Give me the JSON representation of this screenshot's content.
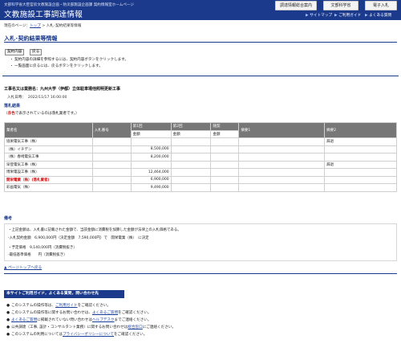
{
  "header": {
    "department": "文部科学省大臣官房文教施設企画・防災部施設企画課 契約情報室ホームページ",
    "site_title": "文教施設工事調達情報",
    "buttons": [
      "調達情報総合案内",
      "文部科学省",
      "電子入札"
    ],
    "nav": [
      "サイトマップ",
      "ご利用ガイド",
      "よくある質問"
    ]
  },
  "breadcrumb": {
    "prefix": "現在のページ：",
    "top": "トップ",
    "sep": " > ",
    "current": "入札･契約結果等情報"
  },
  "page_title": "入札･契約結果等情報",
  "toolbar": {
    "contract_btn": "契約内容",
    "back_btn": "戻る"
  },
  "hints": [
    "・ 契約内容の詳細を参照するには、契約内容ボタンをクリックします。",
    "・ 一覧画面に戻るには、戻るボタンをクリックします。"
  ],
  "work": {
    "name": "工事名又は業務名：九州大学（伊都）立体駐車場他照明更新工事",
    "date_label": "入札日時：",
    "date": "2022/11/17 16:00:00"
  },
  "results_label": "落札結果",
  "legend": {
    "open": "（",
    "red": "赤色",
    "rest": "で表示されているのは落札業者です。）"
  },
  "table": {
    "headers": [
      "業者名",
      "入札番号",
      "第1回",
      "第2回",
      "随契",
      "摘要1",
      "摘要2"
    ],
    "sub": [
      "金額",
      "金額",
      "金額"
    ],
    "rows": [
      {
        "name": "協栄電気工事（株）",
        "amount": "",
        "remark2": "辞退"
      },
      {
        "name": "（株）イチデン",
        "amount": "8,500,000",
        "remark2": ""
      },
      {
        "name": "（株）春崎電気工事",
        "amount": "8,200,000",
        "remark2": ""
      },
      {
        "name": "早登電気工事（株）",
        "amount": "",
        "remark2": "辞退"
      },
      {
        "name": "博栄電設工事（株）",
        "amount": "12,464,000",
        "remark2": ""
      },
      {
        "name": "開栄電業（株）(落札業者)",
        "amount": "6,900,000",
        "remark2": "",
        "winner": true
      },
      {
        "name": "彩画電気（株）",
        "amount": "9,490,000",
        "remark2": ""
      }
    ]
  },
  "biko": {
    "label": "備考",
    "lines": [
      "・上記金額は、入札書に記載された金額で、当該金額に消費税を加算した金額が法律上の入札価格である。",
      "-入札契約金額　6,900,000円（決定金額　7,590,000円）で　開栄電業（株）　に決定",
      "・予定価格　9,140,000円（消費税抜き）",
      "-最低基準価格　　円（消費税抜き）"
    ]
  },
  "back_top": "▲ ページトップへ戻る",
  "guide": {
    "head": "本サイトご利用ガイド，よくある質問，問い合わせ先",
    "lines": [
      {
        "pre": "このシステムの操作等は、",
        "link": "ご利用ガイド",
        "post": "をご確認ください。"
      },
      {
        "pre": "このシステムの操作等に関するお問い合わせは、",
        "link": "よくあるご質問",
        "post": "をご確認ください。"
      },
      {
        "pre": "",
        "link": "よくあるご質問",
        "post": "に掲載されていない問い合わせは",
        "link2": "ヘルプデスク",
        "post2": "までご連絡ください。"
      },
      {
        "pre": "公共調達（工事, 設計・コンサルタント業務）に関するお問い合わせは",
        "link": "総合窓口",
        "post": "にご連絡ください。"
      },
      {
        "pre": "このシステムの利用については",
        "link": "プライバシーポリシーについて",
        "post": "をご確認ください。"
      }
    ]
  }
}
